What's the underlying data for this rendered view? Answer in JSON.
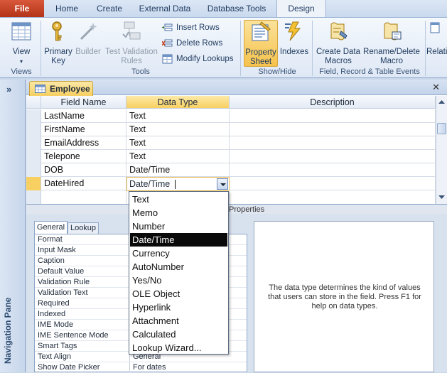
{
  "ribbon": {
    "tabs": [
      "File",
      "Home",
      "Create",
      "External Data",
      "Database Tools",
      "Design"
    ],
    "active_tab": "Design",
    "groups": {
      "views": {
        "label": "Views",
        "view_button": "View"
      },
      "tools": {
        "label": "Tools",
        "primary_key": "Primary Key",
        "builder": "Builder",
        "test_validation": "Test Validation Rules",
        "insert_rows": "Insert Rows",
        "delete_rows": "Delete Rows",
        "modify_lookups": "Modify Lookups"
      },
      "show_hide": {
        "label": "Show/Hide",
        "property_sheet": "Property Sheet",
        "indexes": "Indexes"
      },
      "field_events": {
        "label": "Field, Record & Table Events",
        "create_data_macros": "Create Data Macros",
        "rename_delete_macro": "Rename/Delete Macro"
      },
      "relationships": {
        "label": "Relati"
      }
    }
  },
  "nav_pane": {
    "toggle": "»",
    "title": "Navigation Pane"
  },
  "document": {
    "tab_label": "Employee",
    "close": "✕",
    "columns": [
      "Field Name",
      "Data Type",
      "Description"
    ],
    "rows": [
      {
        "field": "LastName",
        "type": "Text"
      },
      {
        "field": "FirstName",
        "type": "Text"
      },
      {
        "field": "EmailAddress",
        "type": "Text"
      },
      {
        "field": "Telepone",
        "type": "Text"
      },
      {
        "field": "DOB",
        "type": "Date/Time"
      },
      {
        "field": "DateHired",
        "type": "Date/Time"
      }
    ]
  },
  "dropdown": {
    "options": [
      "Text",
      "Memo",
      "Number",
      "Date/Time",
      "Currency",
      "AutoNumber",
      "Yes/No",
      "OLE Object",
      "Hyperlink",
      "Attachment",
      "Calculated",
      "Lookup Wizard..."
    ],
    "selected": "Date/Time"
  },
  "properties": {
    "title": "Properties",
    "tabs": [
      "General",
      "Lookup"
    ],
    "rows": [
      {
        "label": "Format",
        "value": ""
      },
      {
        "label": "Input Mask",
        "value": ""
      },
      {
        "label": "Caption",
        "value": ""
      },
      {
        "label": "Default Value",
        "value": ""
      },
      {
        "label": "Validation Rule",
        "value": ""
      },
      {
        "label": "Validation Text",
        "value": ""
      },
      {
        "label": "Required",
        "value": ""
      },
      {
        "label": "Indexed",
        "value": ""
      },
      {
        "label": "IME Mode",
        "value": ""
      },
      {
        "label": "IME Sentence Mode",
        "value": ""
      },
      {
        "label": "Smart Tags",
        "value": ""
      },
      {
        "label": "Text Align",
        "value": "General"
      },
      {
        "label": "Show Date Picker",
        "value": "For dates"
      }
    ],
    "help": "The data type determines the kind of values that users can store in the field. Press F1 for help on data types."
  },
  "colors": {
    "accent": "#f8d062",
    "file_tab": "#c4421f",
    "selection": "#0a0a0a"
  }
}
